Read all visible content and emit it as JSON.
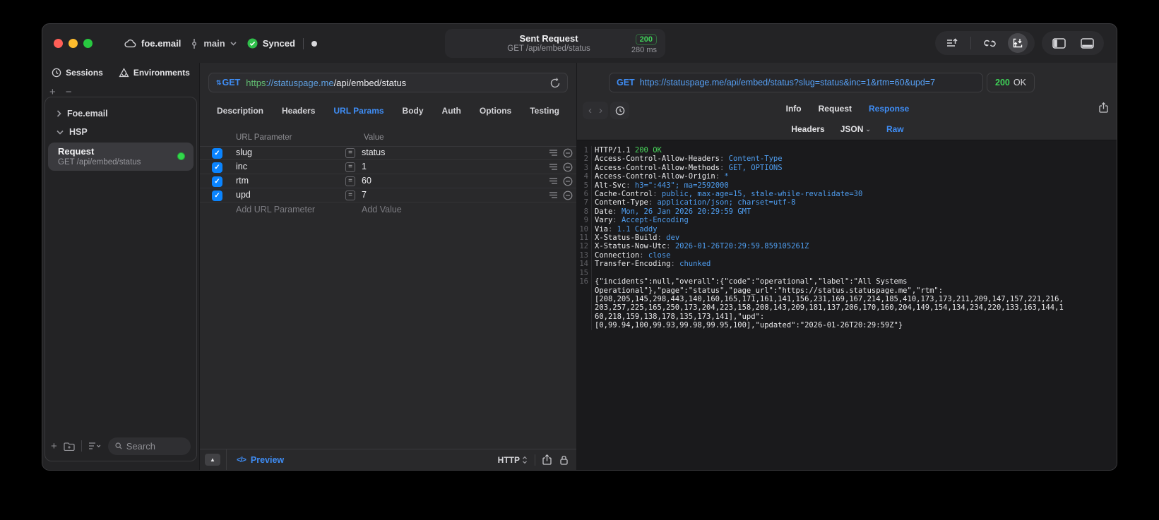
{
  "titlebar": {
    "workspace": "foe.email",
    "branch": "main",
    "sync_status": "Synced",
    "center": {
      "title": "Sent Request",
      "subtitle": "GET /api/embed/status",
      "status_code": "200",
      "duration": "280 ms"
    }
  },
  "sidebar": {
    "tabs": {
      "sessions": "Sessions",
      "environments": "Environments"
    },
    "tree": [
      {
        "label": "Foe.email",
        "expanded": false
      },
      {
        "label": "HSP",
        "expanded": true
      }
    ],
    "request_item": {
      "title": "Request",
      "subtitle": "GET /api/embed/status"
    },
    "search_placeholder": "Search"
  },
  "request_editor": {
    "method": "GET",
    "url": {
      "scheme": "https",
      "host": "://statuspage.me",
      "path": "/api/embed/status"
    },
    "tabs": [
      "Description",
      "Headers",
      "URL Params",
      "Body",
      "Auth",
      "Options",
      "Testing"
    ],
    "active_tab": "URL Params",
    "params": {
      "columns": {
        "name": "URL Parameter",
        "value": "Value"
      },
      "rows": [
        {
          "name": "slug",
          "value": "status",
          "checked": true
        },
        {
          "name": "inc",
          "value": "1",
          "checked": true
        },
        {
          "name": "rtm",
          "value": "60",
          "checked": true
        },
        {
          "name": "upd",
          "value": "7",
          "checked": true
        }
      ],
      "add_name": "Add URL Parameter",
      "add_value": "Add Value"
    },
    "footer": {
      "preview": "Preview",
      "protocol": "HTTP"
    }
  },
  "response_pane": {
    "method": "GET",
    "url": "https://statuspage.me/api/embed/status?slug=status&inc=1&rtm=60&upd=7",
    "status_code": "200",
    "status_text": "OK",
    "tabs": [
      "Info",
      "Request",
      "Response"
    ],
    "active_tab": "Response",
    "subtabs": [
      "Headers",
      "JSON",
      "Raw"
    ],
    "active_subtab": "Raw",
    "lines": [
      {
        "n": "1",
        "parts": [
          {
            "t": "HTTP/1.1 ",
            "c": "p"
          },
          {
            "t": "200 OK",
            "c": "g"
          }
        ]
      },
      {
        "n": "2",
        "parts": [
          {
            "t": "Access-Control-Allow-Headers",
            "c": "p"
          },
          {
            "t": ": ",
            "c": "d"
          },
          {
            "t": "Content-Type",
            "c": "b"
          }
        ]
      },
      {
        "n": "3",
        "parts": [
          {
            "t": "Access-Control-Allow-Methods",
            "c": "p"
          },
          {
            "t": ": ",
            "c": "d"
          },
          {
            "t": "GET, OPTIONS",
            "c": "b"
          }
        ]
      },
      {
        "n": "4",
        "parts": [
          {
            "t": "Access-Control-Allow-Origin",
            "c": "p"
          },
          {
            "t": ": ",
            "c": "d"
          },
          {
            "t": "*",
            "c": "b"
          }
        ]
      },
      {
        "n": "5",
        "parts": [
          {
            "t": "Alt-Svc",
            "c": "p"
          },
          {
            "t": ": ",
            "c": "d"
          },
          {
            "t": "h3=\":443\"; ma=2592000",
            "c": "b"
          }
        ]
      },
      {
        "n": "6",
        "parts": [
          {
            "t": "Cache-Control",
            "c": "p"
          },
          {
            "t": ": ",
            "c": "d"
          },
          {
            "t": "public, max-age=15, stale-while-revalidate=30",
            "c": "b"
          }
        ]
      },
      {
        "n": "7",
        "parts": [
          {
            "t": "Content-Type",
            "c": "p"
          },
          {
            "t": ": ",
            "c": "d"
          },
          {
            "t": "application/json; charset=utf-8",
            "c": "b"
          }
        ]
      },
      {
        "n": "8",
        "parts": [
          {
            "t": "Date",
            "c": "p"
          },
          {
            "t": ": ",
            "c": "d"
          },
          {
            "t": "Mon, 26 Jan 2026 20:29:59 GMT",
            "c": "b"
          }
        ]
      },
      {
        "n": "9",
        "parts": [
          {
            "t": "Vary",
            "c": "p"
          },
          {
            "t": ": ",
            "c": "d"
          },
          {
            "t": "Accept-Encoding",
            "c": "b"
          }
        ]
      },
      {
        "n": "10",
        "parts": [
          {
            "t": "Via",
            "c": "p"
          },
          {
            "t": ": ",
            "c": "d"
          },
          {
            "t": "1.1 Caddy",
            "c": "b"
          }
        ]
      },
      {
        "n": "11",
        "parts": [
          {
            "t": "X-Status-Build",
            "c": "p"
          },
          {
            "t": ": ",
            "c": "d"
          },
          {
            "t": "dev",
            "c": "b"
          }
        ]
      },
      {
        "n": "12",
        "parts": [
          {
            "t": "X-Status-Now-Utc",
            "c": "p"
          },
          {
            "t": ": ",
            "c": "d"
          },
          {
            "t": "2026-01-26T20:29:59.859105261Z",
            "c": "b"
          }
        ]
      },
      {
        "n": "13",
        "parts": [
          {
            "t": "Connection",
            "c": "p"
          },
          {
            "t": ": ",
            "c": "d"
          },
          {
            "t": "close",
            "c": "b"
          }
        ]
      },
      {
        "n": "14",
        "parts": [
          {
            "t": "Transfer-Encoding",
            "c": "p"
          },
          {
            "t": ": ",
            "c": "d"
          },
          {
            "t": "chunked",
            "c": "b"
          }
        ]
      },
      {
        "n": "15",
        "parts": []
      },
      {
        "n": "16",
        "parts": [
          {
            "t": "{\"incidents\":null,\"overall\":{\"code\":\"operational\",\"label\":\"All Systems",
            "c": "p"
          }
        ]
      },
      {
        "n": "",
        "parts": [
          {
            "t": "Operational\"},\"page\":\"status\",\"page_url\":\"https://status.statuspage.me\",\"rtm\":",
            "c": "p"
          }
        ]
      },
      {
        "n": "",
        "parts": [
          {
            "t": "[208,205,145,298,443,140,160,165,171,161,141,156,231,169,167,214,185,410,173,173,211,209,147,157,221,216,",
            "c": "p"
          }
        ]
      },
      {
        "n": "",
        "parts": [
          {
            "t": "203,257,225,165,250,173,204,223,158,208,143,209,181,137,206,170,160,204,149,154,134,234,220,133,163,144,1",
            "c": "p"
          }
        ]
      },
      {
        "n": "",
        "parts": [
          {
            "t": "60,218,159,138,178,135,173,141],\"upd\":",
            "c": "p"
          }
        ]
      },
      {
        "n": "",
        "parts": [
          {
            "t": "[0,99.94,100,99.93,99.98,99.95,100],\"updated\":\"2026-01-26T20:29:59Z\"}",
            "c": "p"
          }
        ]
      }
    ]
  },
  "colors": {
    "accent_blue": "#3f8ef7",
    "green": "#32d74b",
    "value_blue": "#4f9ef0",
    "status_green": "#3fd158"
  }
}
